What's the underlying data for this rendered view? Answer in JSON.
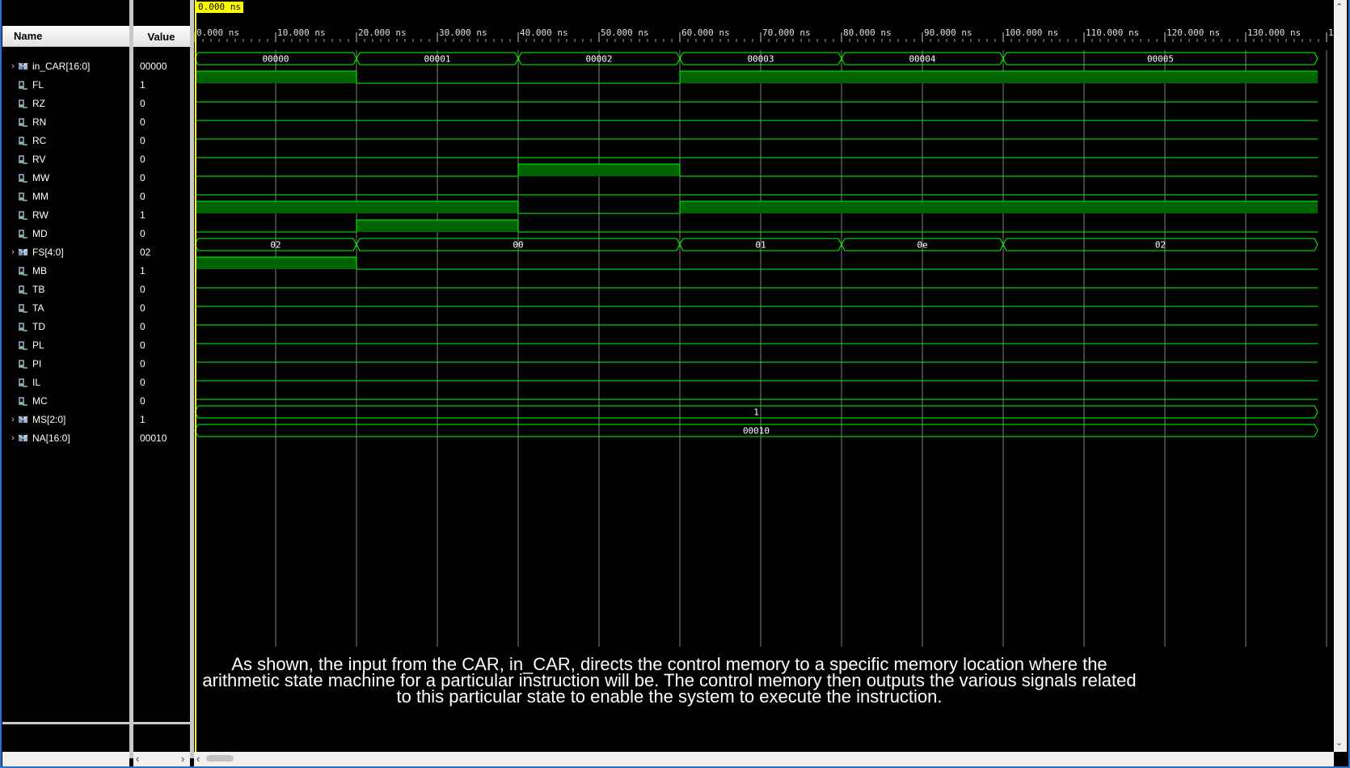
{
  "cursor": {
    "time_label": "0.000 ns"
  },
  "columns": {
    "name": "Name",
    "value": "Value"
  },
  "signals": [
    {
      "name": "in_CAR[16:0]",
      "value": "00000",
      "bus": true
    },
    {
      "name": "FL",
      "value": "1",
      "bus": false
    },
    {
      "name": "RZ",
      "value": "0",
      "bus": false
    },
    {
      "name": "RN",
      "value": "0",
      "bus": false
    },
    {
      "name": "RC",
      "value": "0",
      "bus": false
    },
    {
      "name": "RV",
      "value": "0",
      "bus": false
    },
    {
      "name": "MW",
      "value": "0",
      "bus": false
    },
    {
      "name": "MM",
      "value": "0",
      "bus": false
    },
    {
      "name": "RW",
      "value": "1",
      "bus": false
    },
    {
      "name": "MD",
      "value": "0",
      "bus": false
    },
    {
      "name": "FS[4:0]",
      "value": "02",
      "bus": true
    },
    {
      "name": "MB",
      "value": "1",
      "bus": false
    },
    {
      "name": "TB",
      "value": "0",
      "bus": false
    },
    {
      "name": "TA",
      "value": "0",
      "bus": false
    },
    {
      "name": "TD",
      "value": "0",
      "bus": false
    },
    {
      "name": "PL",
      "value": "0",
      "bus": false
    },
    {
      "name": "PI",
      "value": "0",
      "bus": false
    },
    {
      "name": "IL",
      "value": "0",
      "bus": false
    },
    {
      "name": "MC",
      "value": "0",
      "bus": false
    },
    {
      "name": "MS[2:0]",
      "value": "1",
      "bus": true
    },
    {
      "name": "NA[16:0]",
      "value": "00010",
      "bus": true
    }
  ],
  "timeline": {
    "unit": "ns",
    "tick_labels": [
      "0.000 ns",
      "10.000 ns",
      "20.000 ns",
      "30.000 ns",
      "40.000 ns",
      "50.000 ns",
      "60.000 ns",
      "70.000 ns",
      "80.000 ns",
      "90.000 ns",
      "100.000 ns",
      "110.000 ns",
      "120.000 ns",
      "130.000 ns",
      "1"
    ]
  },
  "waveforms": {
    "in_CAR[16:0]": [
      [
        "0",
        "00000"
      ],
      [
        "20",
        "00001"
      ],
      [
        "40",
        "00002"
      ],
      [
        "60",
        "00003"
      ],
      [
        "80",
        "00004"
      ],
      [
        "100",
        "00005"
      ]
    ],
    "FL": [
      [
        0,
        1
      ],
      [
        20,
        0
      ],
      [
        60,
        1
      ]
    ],
    "RZ": [
      [
        0,
        0
      ]
    ],
    "RN": [
      [
        0,
        0
      ]
    ],
    "RC": [
      [
        0,
        0
      ]
    ],
    "RV": [
      [
        0,
        0
      ]
    ],
    "MW": [
      [
        0,
        0
      ],
      [
        40,
        1
      ],
      [
        60,
        0
      ]
    ],
    "MM": [
      [
        0,
        0
      ]
    ],
    "RW": [
      [
        0,
        1
      ],
      [
        40,
        0
      ],
      [
        60,
        1
      ]
    ],
    "MD": [
      [
        0,
        0
      ],
      [
        20,
        1
      ],
      [
        40,
        0
      ]
    ],
    "FS[4:0]": [
      [
        "0",
        "02"
      ],
      [
        "20",
        "00"
      ],
      [
        "60",
        "01"
      ],
      [
        "80",
        "0e"
      ],
      [
        "100",
        "02"
      ]
    ],
    "MB": [
      [
        0,
        1
      ],
      [
        20,
        0
      ]
    ],
    "TB": [
      [
        0,
        0
      ]
    ],
    "TA": [
      [
        0,
        0
      ]
    ],
    "TD": [
      [
        0,
        0
      ]
    ],
    "PL": [
      [
        0,
        0
      ]
    ],
    "PI": [
      [
        0,
        0
      ]
    ],
    "IL": [
      [
        0,
        0
      ]
    ],
    "MC": [
      [
        0,
        0
      ]
    ],
    "MS[2:0]": [
      [
        "0",
        "1"
      ]
    ],
    "NA[16:0]": [
      [
        "0",
        "00010"
      ]
    ]
  },
  "caption": "As shown, the input from the CAR, in_CAR, directs the control memory to a specific memory location where the arithmetic state machine for a particular instruction will be. The control memory then outputs the various signals related to this particular state to enable the system to execute the instruction.",
  "colors": {
    "wave": "#00ff00",
    "wave_fill": "#006400",
    "grid": "#808080",
    "cursor": "#ffff00"
  },
  "icons": {
    "bus": "bus-signal-icon",
    "bit": "bit-signal-icon"
  }
}
